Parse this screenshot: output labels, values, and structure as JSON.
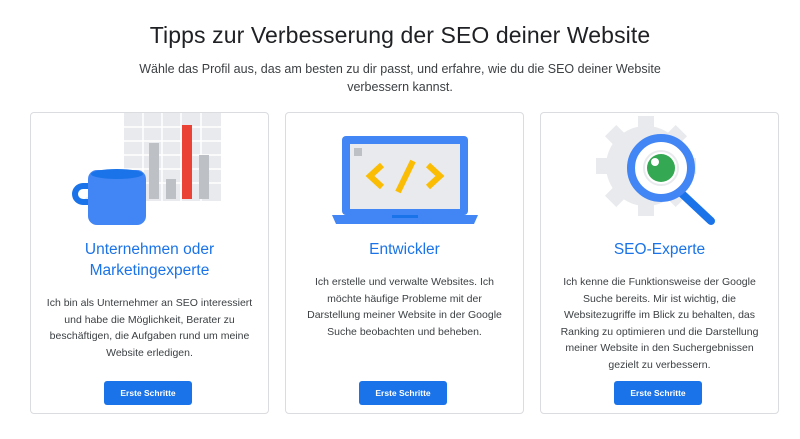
{
  "header": {
    "title": "Tipps zur Verbesserung der SEO deiner Website",
    "subtitle": "Wähle das Profil aus, das am besten zu dir passt, und erfahre, wie du die SEO deiner Website verbessern kannst."
  },
  "cards": [
    {
      "title": "Unternehmen oder Marketingexperte",
      "text": "Ich bin als Unternehmer an SEO interessiert und habe die Möglichkeit, Berater zu beschäftigen, die Aufgaben rund um meine Website erledigen.",
      "button_label": "Erste Schritte",
      "illustration_icon": "coffee-mug-bar-chart-icon"
    },
    {
      "title": "Entwickler",
      "text": "Ich erstelle und verwalte Websites. Ich möchte häufige Probleme mit der Darstellung meiner Website in der Google Suche beobachten und beheben.",
      "button_label": "Erste Schritte",
      "illustration_icon": "laptop-code-icon"
    },
    {
      "title": "SEO-Experte",
      "text": "Ich kenne die Funktionsweise der Google Suche bereits. Mir ist wichtig, die Websitezugriffe im Blick zu behalten, das Ranking zu optimieren und die Darstellung meiner Website in den Suchergebnissen gezielt zu verbessern.",
      "button_label": "Erste Schritte",
      "illustration_icon": "gear-magnifier-icon"
    }
  ],
  "colors": {
    "accent_blue": "#1a73e8",
    "illustration_blue": "#4285f4",
    "illustration_red": "#ea4335",
    "illustration_yellow": "#fbbc04",
    "illustration_green": "#34a853",
    "border": "#dadce0"
  }
}
